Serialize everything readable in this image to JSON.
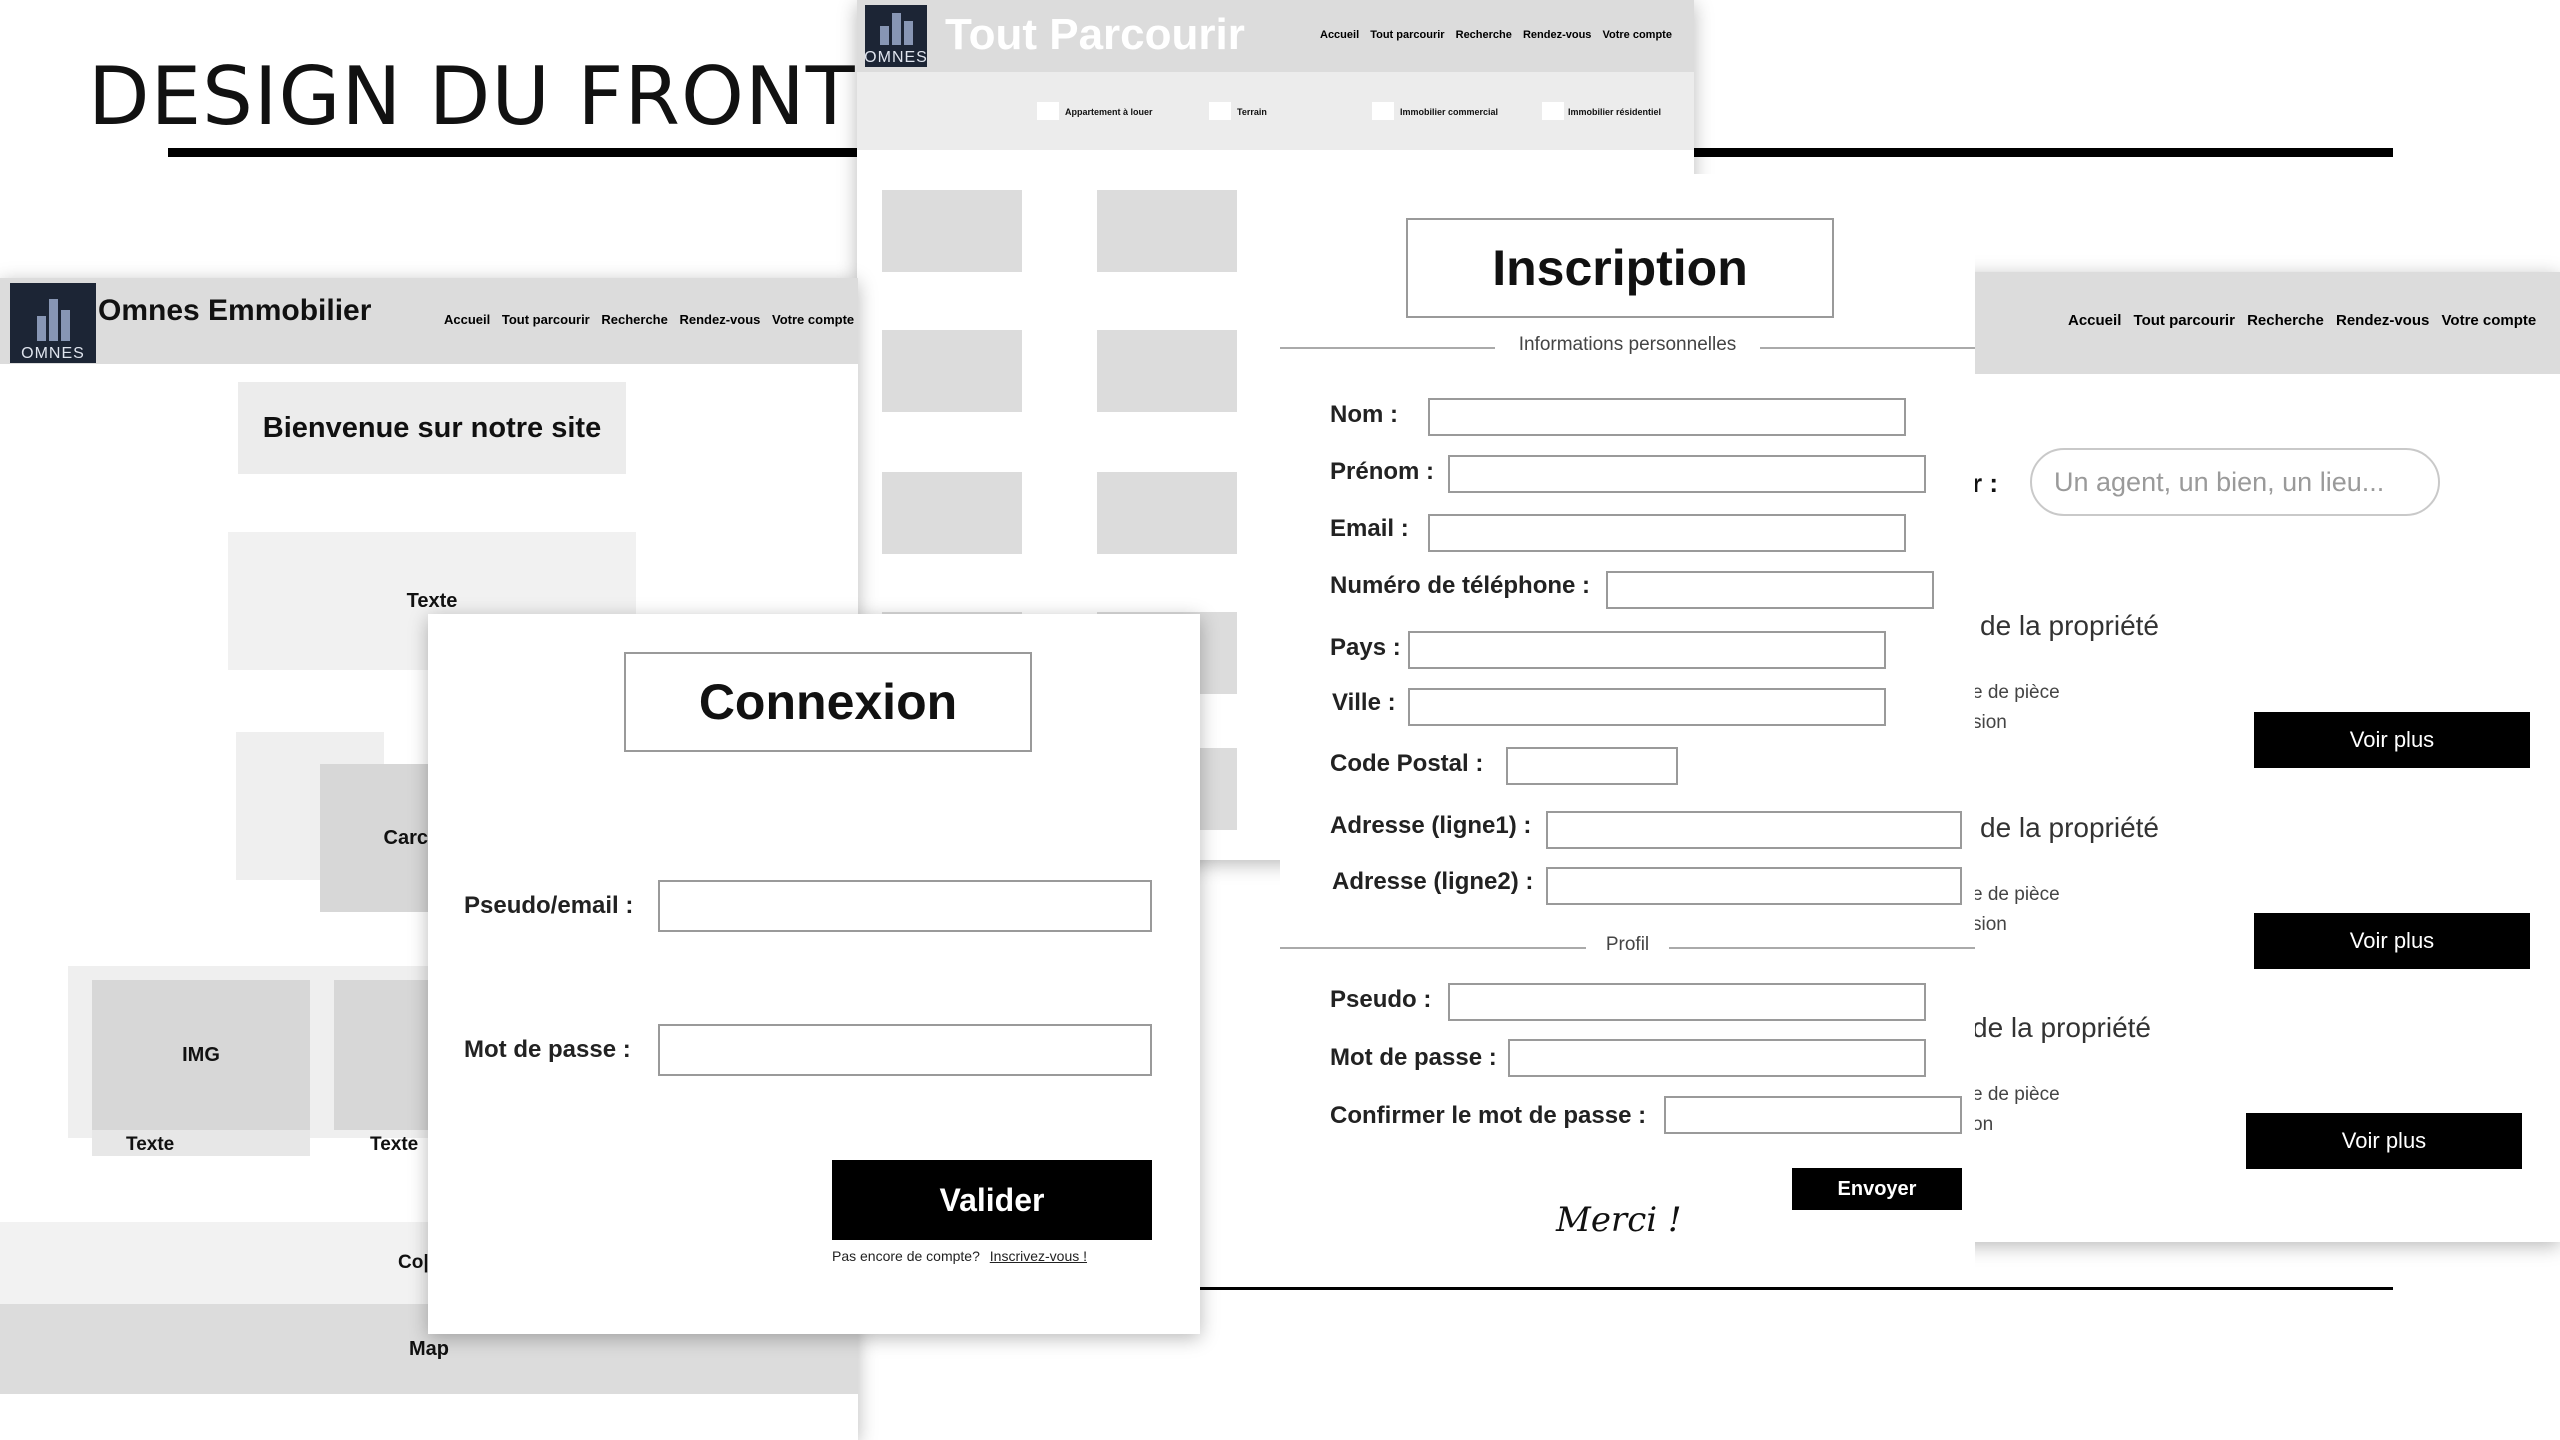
{
  "slide": {
    "title": "DESIGN DU FRONT"
  },
  "tout_parcourir": {
    "title": "Tout Parcourir",
    "logo_text": "OMNES",
    "nav": [
      "Accueil",
      "Tout parcourir",
      "Recherche",
      "Rendez-vous",
      "Votre compte"
    ],
    "filters": [
      "Appartement à louer",
      "Terrain",
      "Immobilier commercial",
      "Immobilier résidentiel"
    ]
  },
  "home": {
    "brand": "Omnes Emmobilier",
    "logo_text": "OMNES",
    "nav": [
      "Accueil",
      "Tout parcourir",
      "Recherche",
      "Rendez-vous",
      "Votre compte"
    ],
    "welcome": "Bienvenue sur notre site",
    "text_block": "Texte",
    "card_label": "Carc",
    "img_label": "IMG",
    "card_text_1": "Texte",
    "card_text_2": "Texte",
    "copyright": "Co|",
    "map": "Map"
  },
  "connexion": {
    "title": "Connexion",
    "pseudo_label": "Pseudo/email :",
    "password_label": "Mot de passe :",
    "submit": "Valider",
    "no_account": "Pas encore de compte?",
    "signup_link": "Inscrivez-vous !"
  },
  "inscription": {
    "title": "Inscription",
    "section_personal": "Informations personnelles",
    "fields": {
      "nom": "Nom :",
      "prenom": "Prénom :",
      "email": "Email :",
      "phone": "Numéro de téléphone :",
      "pays": "Pays :",
      "ville": "Ville :",
      "code_postal": "Code Postal :",
      "adresse1": "Adresse (ligne1) :",
      "adresse2": "Adresse (ligne2) :"
    },
    "section_profile": "Profil",
    "profile_fields": {
      "pseudo": "Pseudo :",
      "password": "Mot de passe :",
      "confirm": "Confirmer le mot de passe :"
    },
    "submit": "Envoyer",
    "thanks": "Merci !"
  },
  "recherche": {
    "nav": [
      "Accueil",
      "Tout parcourir",
      "Recherche",
      "Rendez-vous",
      "Votre compte"
    ],
    "search_label_fragment": "r :",
    "search_placeholder": "Un agent, un bien, un lieu...",
    "results": [
      {
        "title": "de la propriété",
        "line1": "e de pièce",
        "line2": "sion",
        "button": "Voir plus"
      },
      {
        "title": "de la propriété",
        "line1": "e de pièce",
        "line2": "sion",
        "button": "Voir plus"
      },
      {
        "title": "de la propriété",
        "line1": "e de pièce",
        "line2": "on",
        "button": "Voir plus"
      }
    ]
  },
  "colors": {
    "wire_gray": "#dcdcdc",
    "light_gray": "#ececec",
    "black": "#000000",
    "logo_navy": "#1c2535"
  }
}
